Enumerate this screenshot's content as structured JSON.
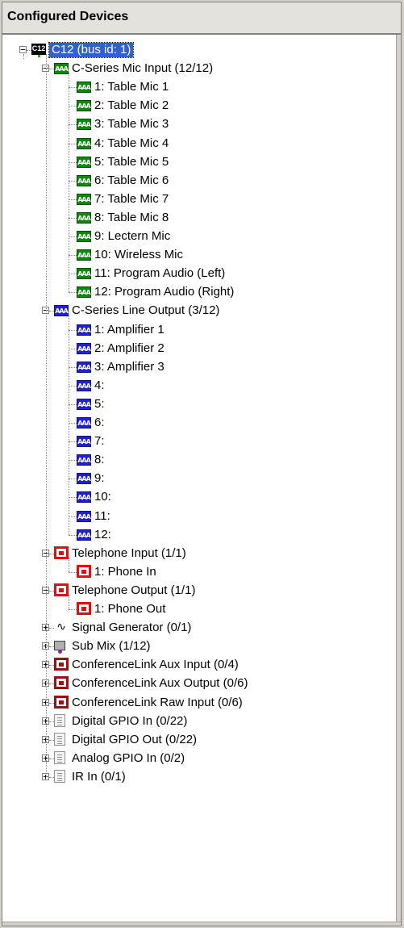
{
  "panel": {
    "title": "Configured Devices"
  },
  "root": {
    "label": "C12 (bus id: 1)",
    "icon": "c12-device-icon",
    "badge": "C12"
  },
  "groups": {
    "mic": {
      "label": "C-Series Mic Input (12/12)",
      "icon_text": "AAA",
      "children": [
        "1: Table Mic 1",
        "2: Table Mic 2",
        "3: Table Mic 3",
        "4: Table Mic 4",
        "5: Table Mic 5",
        "6: Table Mic 6",
        "7: Table Mic 7",
        "8: Table Mic 8",
        "9: Lectern Mic",
        "10: Wireless Mic",
        "11: Program Audio (Left)",
        "12: Program Audio (Right)"
      ]
    },
    "line_out": {
      "label": "C-Series Line Output (3/12)",
      "icon_text": "AAA",
      "children": [
        "1: Amplifier 1",
        "2: Amplifier 2",
        "3: Amplifier 3",
        "4:",
        "5:",
        "6:",
        "7:",
        "8:",
        "9:",
        "10:",
        "11:",
        "12:"
      ]
    },
    "tel_in": {
      "label": "Telephone Input (1/1)",
      "children": [
        "1: Phone In"
      ]
    },
    "tel_out": {
      "label": "Telephone Output (1/1)",
      "children": [
        "1: Phone Out"
      ]
    },
    "collapsed": [
      {
        "label": "Signal Generator (0/1)",
        "icon": "signal-generator-icon",
        "glyph": "∿"
      },
      {
        "label": "Sub Mix (1/12)",
        "icon": "sub-mix-icon"
      },
      {
        "label": "ConferenceLink Aux Input (0/4)",
        "icon": "conferencelink-icon"
      },
      {
        "label": "ConferenceLink Aux Output (0/6)",
        "icon": "conferencelink-icon"
      },
      {
        "label": "ConferenceLink Raw Input (0/6)",
        "icon": "conferencelink-icon"
      },
      {
        "label": "Digital GPIO In (0/22)",
        "icon": "gpio-icon"
      },
      {
        "label": "Digital GPIO Out (0/22)",
        "icon": "gpio-icon"
      },
      {
        "label": "Analog GPIO In (0/2)",
        "icon": "gpio-icon"
      },
      {
        "label": "IR In (0/1)",
        "icon": "gpio-icon"
      }
    ]
  },
  "toggles": {
    "expanded": "−",
    "collapsed": "+"
  },
  "colors": {
    "selection": "#3161cc",
    "mic_green": "#0d8a0d",
    "output_blue": "#2020d8",
    "telephone_red": "#e01010"
  }
}
